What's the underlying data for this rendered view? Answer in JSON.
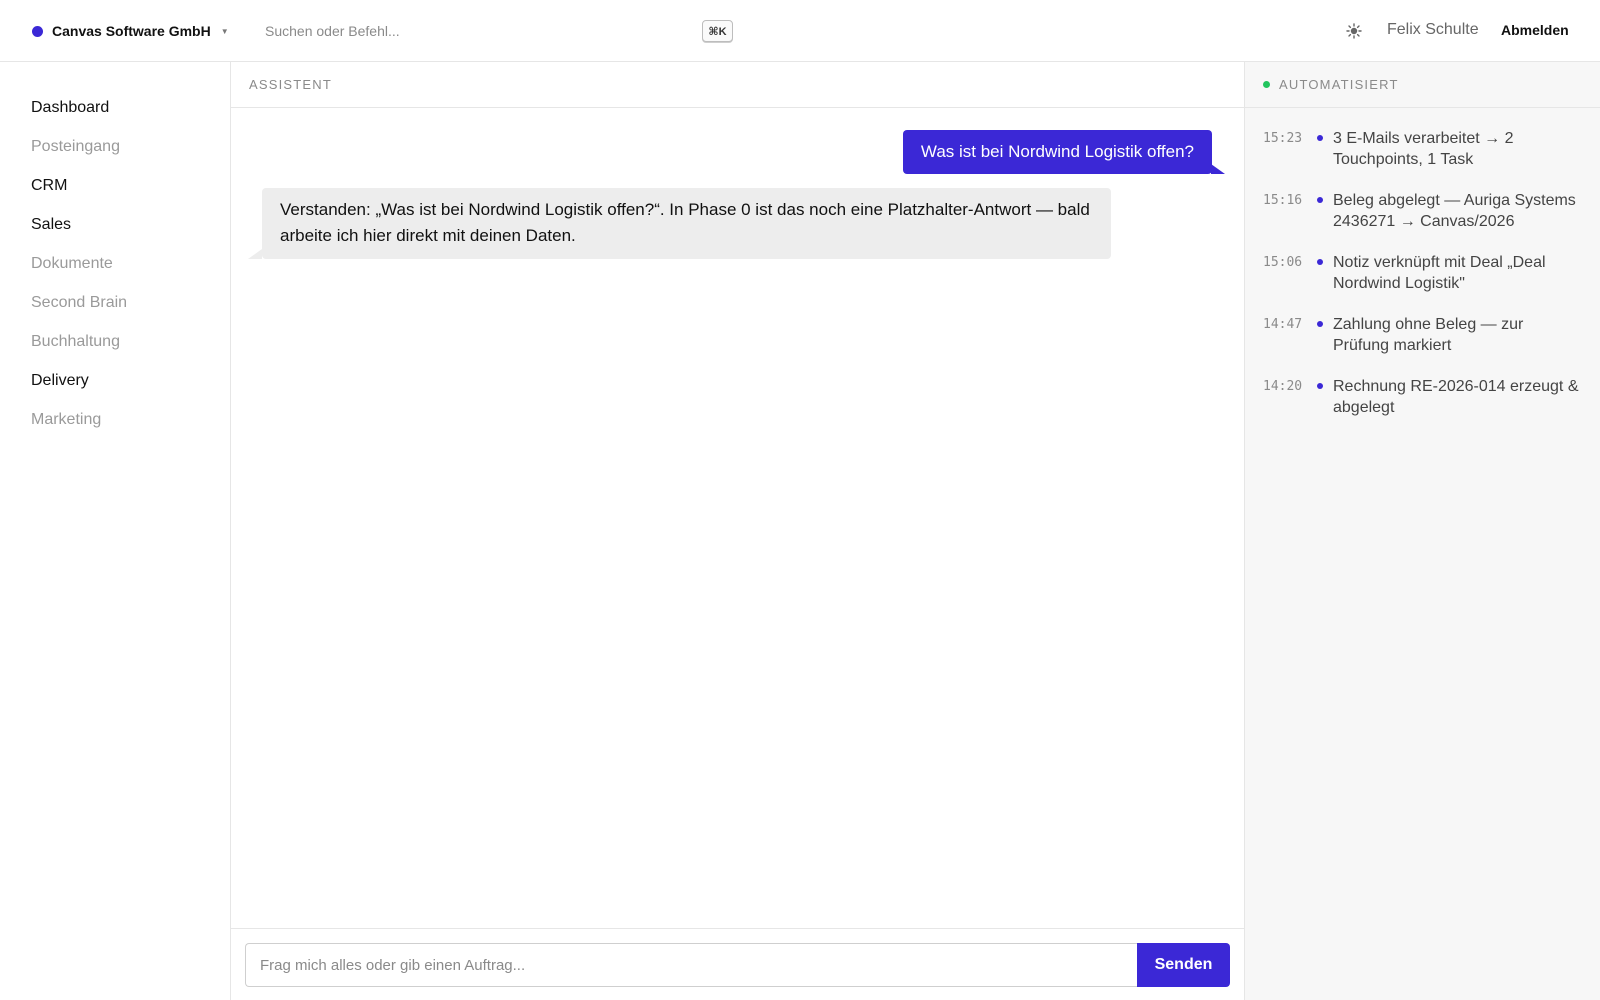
{
  "colors": {
    "accent": "#3b28d6",
    "status_ok": "#22c55e",
    "assistant_bubble": "#ededed",
    "panel_bg": "#f7f7f7"
  },
  "header": {
    "workspace": "Canvas Software GmbH",
    "workspace_caret_icon": "chevron-down-icon",
    "search_placeholder": "Suchen oder Befehl...",
    "search_shortcut": "⌘K",
    "theme_icon": "sun-icon",
    "user_name": "Felix Schulte",
    "logout_label": "Abmelden"
  },
  "sidebar": {
    "items": [
      {
        "label": "Dashboard",
        "state": "active"
      },
      {
        "label": "Posteingang",
        "state": "muted"
      },
      {
        "label": "CRM",
        "state": "active"
      },
      {
        "label": "Sales",
        "state": "active"
      },
      {
        "label": "Dokumente",
        "state": "muted"
      },
      {
        "label": "Second Brain",
        "state": "muted"
      },
      {
        "label": "Buchhaltung",
        "state": "muted"
      },
      {
        "label": "Delivery",
        "state": "active"
      },
      {
        "label": "Marketing",
        "state": "muted"
      }
    ]
  },
  "chat": {
    "section_label": "ASSISTENT",
    "messages": {
      "user": "Was ist bei Nordwind Logistik offen?",
      "assistant": "Verstanden: „Was ist bei Nordwind Logistik offen?“. In Phase 0 ist das noch eine Platzhalter-Antwort — bald arbeite ich hier direkt mit deinen Daten."
    },
    "composer_placeholder": "Frag mich alles oder gib einen Auftrag...",
    "send_label": "Senden"
  },
  "automation": {
    "section_label": "AUTOMATISIERT",
    "items": [
      {
        "time": "15:23",
        "text": "3 E-Mails verarbeitet → 2 Touchpoints, 1 Task"
      },
      {
        "time": "15:16",
        "text": "Beleg abgelegt — Auriga Systems 2436271 → Canvas/2026"
      },
      {
        "time": "15:06",
        "text": "Notiz verknüpft mit Deal „Deal Nordwind Logistik\""
      },
      {
        "time": "14:47",
        "text": "Zahlung ohne Beleg — zur Prüfung markiert"
      },
      {
        "time": "14:20",
        "text": "Rechnung RE-2026-014 erzeugt & abgelegt"
      }
    ]
  }
}
